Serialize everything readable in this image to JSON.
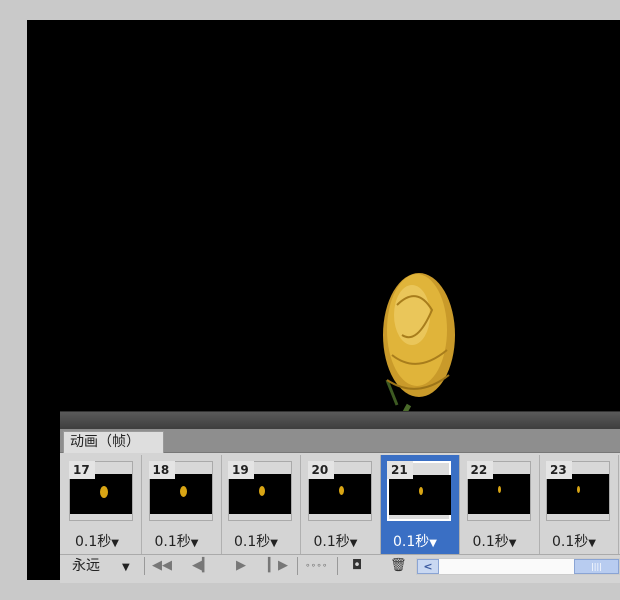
{
  "panel": {
    "tab_label": "动画（帧）"
  },
  "frames": [
    {
      "number": "17",
      "delay": "0.1秒",
      "selected": false
    },
    {
      "number": "18",
      "delay": "0.1秒",
      "selected": false
    },
    {
      "number": "19",
      "delay": "0.1秒",
      "selected": false
    },
    {
      "number": "20",
      "delay": "0.1秒",
      "selected": false
    },
    {
      "number": "21",
      "delay": "0.1秒",
      "selected": true
    },
    {
      "number": "22",
      "delay": "0.1秒",
      "selected": false
    },
    {
      "number": "23",
      "delay": "0.1秒",
      "selected": false
    }
  ],
  "bottombar": {
    "loop_option": "永远",
    "icons": [
      "first-frame-icon",
      "previous-frame-icon",
      "play-icon",
      "next-frame-icon",
      "tween-icon",
      "duplicate-frame-icon",
      "delete-frame-icon"
    ]
  },
  "colors": {
    "selection": "#3a6fc4",
    "canvas": "#000000",
    "rose": "#e0b43a"
  }
}
